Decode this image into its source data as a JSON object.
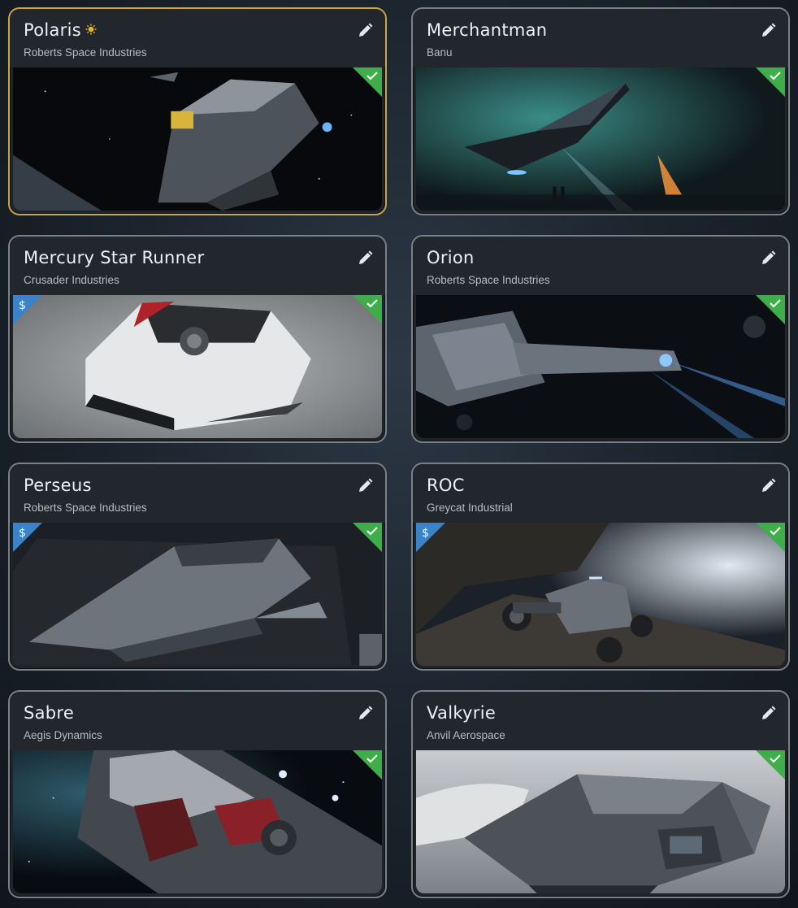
{
  "ships": [
    {
      "name": "Polaris",
      "manufacturer": "Roberts Space Industries",
      "flagship": true,
      "pledge": false,
      "owned": true,
      "image_icon": "polaris-ship-image"
    },
    {
      "name": "Merchantman",
      "manufacturer": "Banu",
      "flagship": false,
      "pledge": false,
      "owned": true,
      "image_icon": "merchantman-ship-image"
    },
    {
      "name": "Mercury Star Runner",
      "manufacturer": "Crusader Industries",
      "flagship": false,
      "pledge": true,
      "owned": true,
      "image_icon": "mercury-star-runner-ship-image"
    },
    {
      "name": "Orion",
      "manufacturer": "Roberts Space Industries",
      "flagship": false,
      "pledge": false,
      "owned": true,
      "image_icon": "orion-ship-image"
    },
    {
      "name": "Perseus",
      "manufacturer": "Roberts Space Industries",
      "flagship": false,
      "pledge": true,
      "owned": true,
      "image_icon": "perseus-ship-image"
    },
    {
      "name": "ROC",
      "manufacturer": "Greycat Industrial",
      "flagship": false,
      "pledge": true,
      "owned": true,
      "image_icon": "roc-ship-image"
    },
    {
      "name": "Sabre",
      "manufacturer": "Aegis Dynamics",
      "flagship": false,
      "pledge": false,
      "owned": true,
      "image_icon": "sabre-ship-image"
    },
    {
      "name": "Valkyrie",
      "manufacturer": "Anvil Aerospace",
      "flagship": false,
      "pledge": false,
      "owned": true,
      "image_icon": "valkyrie-ship-image"
    }
  ],
  "badges": {
    "pledge_symbol": "$",
    "owned_color": "#3fae4a",
    "pledge_color": "#3b82c8",
    "flagship_color": "#e8b820",
    "featured_border_color": "#c8a640"
  }
}
